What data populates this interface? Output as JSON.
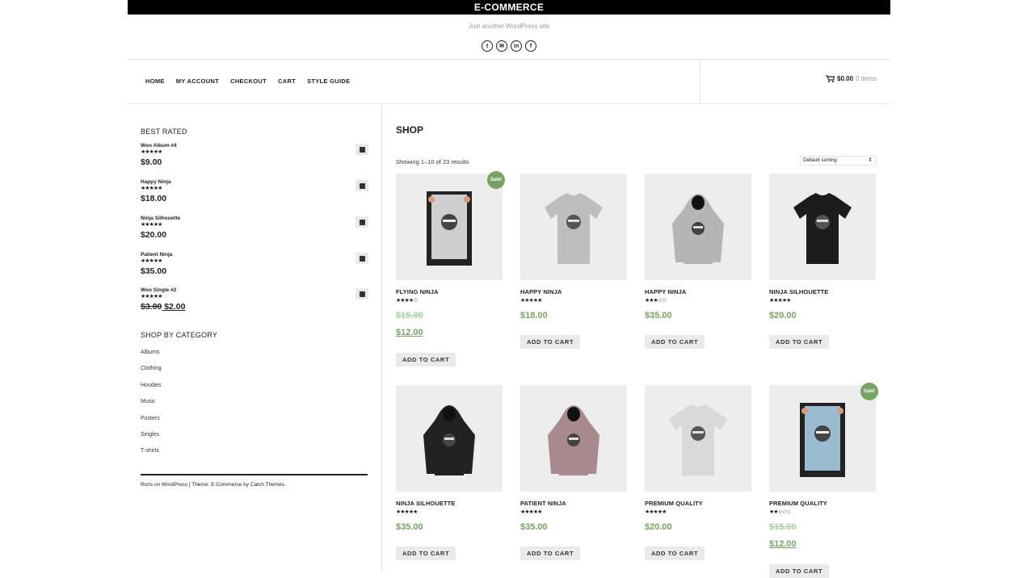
{
  "header": {
    "site_title": "E-COMMERCE",
    "tagline": "Just another WordPress site",
    "social_icons": [
      "twitter-icon",
      "email-icon",
      "linkedin-icon",
      "facebook-icon"
    ]
  },
  "nav": {
    "items": [
      "HOME",
      "MY ACCOUNT",
      "CHECKOUT",
      "CART",
      "STYLE GUIDE"
    ]
  },
  "cart": {
    "amount": "$0.00",
    "items": "0 items"
  },
  "sidebar": {
    "best_rated_title": "BEST RATED",
    "best_rated": [
      {
        "name": "Woo Album #4",
        "stars": 5,
        "price": "$9.00"
      },
      {
        "name": "Happy Ninja",
        "stars": 5,
        "price": "$18.00"
      },
      {
        "name": "Ninja Silhouette",
        "stars": 5,
        "price": "$20.00"
      },
      {
        "name": "Patient Ninja",
        "stars": 5,
        "price": "$35.00"
      },
      {
        "name": "Woo Single #2",
        "stars": 4.5,
        "old_price": "$3.00",
        "price": "$2.00"
      }
    ],
    "category_title": "SHOP BY CATEGORY",
    "categories": [
      "Albums",
      "Clothing",
      "Hoodies",
      "Music",
      "Posters",
      "Singles",
      "T-shirts"
    ],
    "footer": "Runs on WordPress | Theme: E-Commerce by Catch Themes."
  },
  "shop": {
    "title": "SHOP",
    "showing": "Showing 1–10 of 23 results",
    "sorting": "Default sorting",
    "sale_label": "Sale!",
    "add_to_cart": "ADD TO CART",
    "products": [
      {
        "name": "FLYING NINJA",
        "stars": 4,
        "old_price": "$15.00",
        "price": "$12.00",
        "sale": true,
        "kind": "poster",
        "color": "#cfcfcf"
      },
      {
        "name": "HAPPY NINJA",
        "stars": 5,
        "price": "$18.00",
        "sale": false,
        "kind": "tshirt",
        "color": "#bdbdbd"
      },
      {
        "name": "HAPPY NINJA",
        "stars": 3,
        "price": "$35.00",
        "sale": false,
        "kind": "hoodie",
        "color": "#b5b5b5"
      },
      {
        "name": "NINJA SILHOUETTE",
        "stars": 5,
        "price": "$20.00",
        "sale": false,
        "kind": "tshirt",
        "color": "#1c1c1c"
      },
      {
        "name": "NINJA SILHOUETTE",
        "stars": 4.5,
        "price": "$35.00",
        "sale": false,
        "kind": "hoodie",
        "color": "#222222"
      },
      {
        "name": "PATIENT NINJA",
        "stars": 5,
        "price": "$35.00",
        "sale": false,
        "kind": "hoodie",
        "color": "#a88a8e"
      },
      {
        "name": "PREMIUM QUALITY",
        "stars": 4.5,
        "price": "$20.00",
        "sale": false,
        "kind": "tshirt",
        "color": "#d9d9d9"
      },
      {
        "name": "PREMIUM QUALITY",
        "stars": 2,
        "old_price": "$15.00",
        "price": "$12.00",
        "sale": true,
        "kind": "poster",
        "color": "#9bbbd0"
      }
    ]
  },
  "colors": {
    "accent_green": "#77a464",
    "old_price_green": "#a9d39e",
    "button_bg": "#ebe9eb"
  }
}
